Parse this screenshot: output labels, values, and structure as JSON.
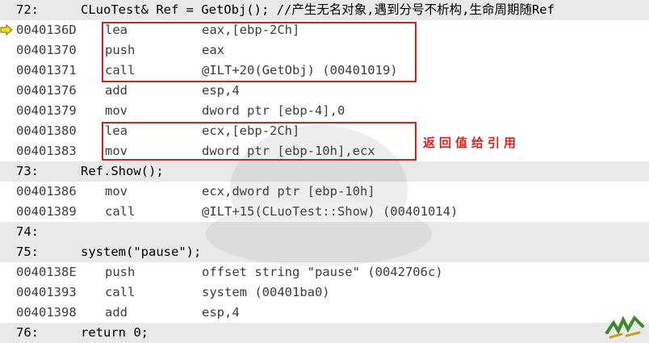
{
  "source_lines": {
    "l72": {
      "num": "72:",
      "code": "CLuoTest& Ref = GetObj(); //产生无名对象,遇到分号不析构,生命周期随Ref"
    },
    "l73": {
      "num": "73:",
      "code": "Ref.Show();"
    },
    "l74": {
      "num": "74:",
      "code": ""
    },
    "l75": {
      "num": "75:",
      "code": "system(\"pause\");"
    },
    "l76": {
      "num": "76:",
      "code": "return 0;"
    }
  },
  "asm": [
    {
      "addr": "0040136D",
      "op": "lea",
      "arg": "eax,[ebp-2Ch]"
    },
    {
      "addr": "00401370",
      "op": "push",
      "arg": "eax"
    },
    {
      "addr": "00401371",
      "op": "call",
      "arg": "@ILT+20(GetObj) (00401019)"
    },
    {
      "addr": "00401376",
      "op": "add",
      "arg": "esp,4"
    },
    {
      "addr": "00401379",
      "op": "mov",
      "arg": "dword ptr [ebp-4],0"
    },
    {
      "addr": "00401380",
      "op": "lea",
      "arg": "ecx,[ebp-2Ch]"
    },
    {
      "addr": "00401383",
      "op": "mov",
      "arg": "dword ptr [ebp-10h],ecx"
    },
    {
      "addr": "00401386",
      "op": "mov",
      "arg": "ecx,dword ptr [ebp-10h]"
    },
    {
      "addr": "00401389",
      "op": "call",
      "arg": "@ILT+15(CLuoTest::Show) (00401014)"
    },
    {
      "addr": "0040138E",
      "op": "push",
      "arg": "offset string \"pause\" (0042706c)"
    },
    {
      "addr": "00401393",
      "op": "call",
      "arg": "system (00401ba0)"
    },
    {
      "addr": "00401398",
      "op": "add",
      "arg": "esp,4"
    }
  ],
  "annotation": {
    "text": "返回值给引用"
  },
  "colors": {
    "highlight_box": "#cc2222",
    "annotation": "#e02020",
    "source_row_bg": "#e9e9e9",
    "current_line_arrow": "#f0e020"
  },
  "icons": {
    "current_line": "yellow-arrow-icon",
    "stamp": "stamp-icon"
  }
}
